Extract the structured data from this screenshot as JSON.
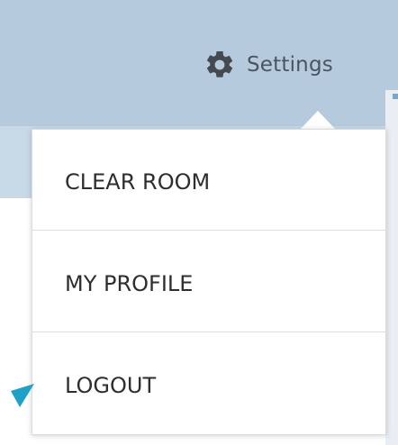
{
  "header": {
    "settings_label": "Settings",
    "settings_icon": "gear-icon"
  },
  "dropdown": {
    "items": [
      {
        "label": "CLEAR ROOM"
      },
      {
        "label": "MY PROFILE"
      },
      {
        "label": "LOGOUT"
      }
    ]
  },
  "colors": {
    "header_background": "#b6cade",
    "menu_background": "#ffffff",
    "menu_text": "#2e2e2e",
    "annotation_arrow": "#1fa0c6"
  }
}
